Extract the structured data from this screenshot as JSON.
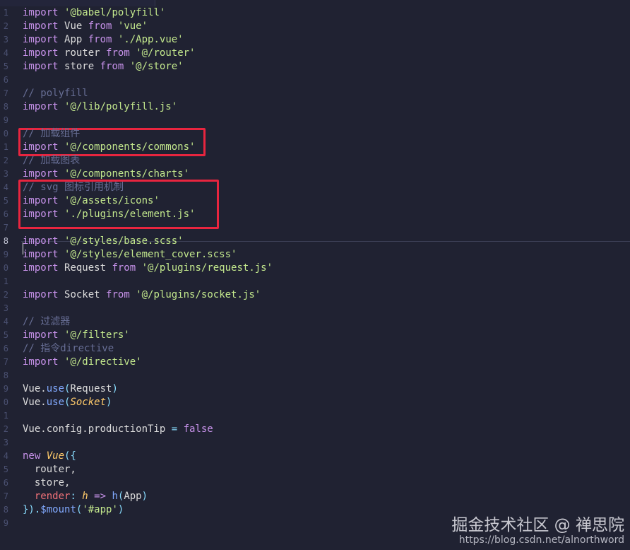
{
  "editor": {
    "lines": [
      {
        "n": "1",
        "t": [
          {
            "c": "kw",
            "s": "import "
          },
          {
            "c": "str",
            "s": "'@babel/polyfill'"
          }
        ]
      },
      {
        "n": "2",
        "t": [
          {
            "c": "kw",
            "s": "import "
          },
          {
            "c": "",
            "s": "Vue "
          },
          {
            "c": "kw",
            "s": "from "
          },
          {
            "c": "str",
            "s": "'vue'"
          }
        ]
      },
      {
        "n": "3",
        "t": [
          {
            "c": "kw",
            "s": "import "
          },
          {
            "c": "",
            "s": "App "
          },
          {
            "c": "kw",
            "s": "from "
          },
          {
            "c": "str",
            "s": "'./App.vue'"
          }
        ]
      },
      {
        "n": "4",
        "t": [
          {
            "c": "kw",
            "s": "import "
          },
          {
            "c": "",
            "s": "router "
          },
          {
            "c": "kw",
            "s": "from "
          },
          {
            "c": "str",
            "s": "'@/router'"
          }
        ]
      },
      {
        "n": "5",
        "t": [
          {
            "c": "kw",
            "s": "import "
          },
          {
            "c": "",
            "s": "store "
          },
          {
            "c": "kw",
            "s": "from "
          },
          {
            "c": "str",
            "s": "'@/store'"
          }
        ]
      },
      {
        "n": "6",
        "t": []
      },
      {
        "n": "7",
        "t": [
          {
            "c": "cm",
            "s": "// polyfill"
          }
        ]
      },
      {
        "n": "8",
        "t": [
          {
            "c": "kw",
            "s": "import "
          },
          {
            "c": "str",
            "s": "'@/lib/polyfill.js'"
          }
        ]
      },
      {
        "n": "9",
        "t": []
      },
      {
        "n": "0",
        "t": [
          {
            "c": "cm",
            "s": "// 加载组件"
          }
        ]
      },
      {
        "n": "1",
        "t": [
          {
            "c": "kw",
            "s": "import "
          },
          {
            "c": "str",
            "s": "'@/components/commons'"
          }
        ]
      },
      {
        "n": "2",
        "t": [
          {
            "c": "cm",
            "s": "// 加载图表"
          }
        ]
      },
      {
        "n": "3",
        "t": [
          {
            "c": "kw",
            "s": "import "
          },
          {
            "c": "str",
            "s": "'@/components/charts'"
          }
        ]
      },
      {
        "n": "4",
        "t": [
          {
            "c": "cm",
            "s": "// svg 图标引用机制"
          }
        ]
      },
      {
        "n": "5",
        "t": [
          {
            "c": "kw",
            "s": "import "
          },
          {
            "c": "str",
            "s": "'@/assets/icons'"
          }
        ]
      },
      {
        "n": "6",
        "t": [
          {
            "c": "kw",
            "s": "import "
          },
          {
            "c": "str",
            "s": "'./plugins/element.js'"
          }
        ]
      },
      {
        "n": "7",
        "t": []
      },
      {
        "n": "8",
        "t": [
          {
            "c": "kw",
            "s": "import "
          },
          {
            "c": "str",
            "s": "'@/styles/base.scss'"
          }
        ],
        "active": true
      },
      {
        "n": "9",
        "t": [
          {
            "c": "kw",
            "s": "import "
          },
          {
            "c": "str",
            "s": "'@/styles/element_cover.scss'"
          }
        ]
      },
      {
        "n": "0",
        "t": [
          {
            "c": "kw",
            "s": "import "
          },
          {
            "c": "",
            "s": "Request "
          },
          {
            "c": "kw",
            "s": "from "
          },
          {
            "c": "str",
            "s": "'@/plugins/request.js'"
          }
        ]
      },
      {
        "n": "1",
        "t": []
      },
      {
        "n": "2",
        "t": [
          {
            "c": "kw",
            "s": "import "
          },
          {
            "c": "",
            "s": "Socket "
          },
          {
            "c": "kw",
            "s": "from "
          },
          {
            "c": "str",
            "s": "'@/plugins/socket.js'"
          }
        ]
      },
      {
        "n": "3",
        "t": []
      },
      {
        "n": "4",
        "t": [
          {
            "c": "cm",
            "s": "// 过滤器"
          }
        ]
      },
      {
        "n": "5",
        "t": [
          {
            "c": "kw",
            "s": "import "
          },
          {
            "c": "str",
            "s": "'@/filters'"
          }
        ]
      },
      {
        "n": "6",
        "t": [
          {
            "c": "cm",
            "s": "// 指令directive"
          }
        ]
      },
      {
        "n": "7",
        "t": [
          {
            "c": "kw",
            "s": "import "
          },
          {
            "c": "str",
            "s": "'@/directive'"
          }
        ]
      },
      {
        "n": "8",
        "t": []
      },
      {
        "n": "9",
        "t": [
          {
            "c": "",
            "s": "Vue."
          },
          {
            "c": "fn",
            "s": "use"
          },
          {
            "c": "pn",
            "s": "("
          },
          {
            "c": "",
            "s": "Request"
          },
          {
            "c": "pn",
            "s": ")"
          }
        ]
      },
      {
        "n": "0",
        "t": [
          {
            "c": "",
            "s": "Vue."
          },
          {
            "c": "fn",
            "s": "use"
          },
          {
            "c": "pn",
            "s": "("
          },
          {
            "c": "cls",
            "s": "Socket"
          },
          {
            "c": "pn",
            "s": ")"
          }
        ]
      },
      {
        "n": "1",
        "t": []
      },
      {
        "n": "2",
        "t": [
          {
            "c": "",
            "s": "Vue.config.productionTip "
          },
          {
            "c": "pn",
            "s": "= "
          },
          {
            "c": "kw",
            "s": "false"
          }
        ]
      },
      {
        "n": "3",
        "t": []
      },
      {
        "n": "4",
        "t": [
          {
            "c": "kw",
            "s": "new "
          },
          {
            "c": "cls",
            "s": "Vue"
          },
          {
            "c": "pn",
            "s": "({"
          }
        ]
      },
      {
        "n": "5",
        "t": [
          {
            "c": "",
            "s": "  router,"
          }
        ]
      },
      {
        "n": "6",
        "t": [
          {
            "c": "",
            "s": "  store,"
          }
        ]
      },
      {
        "n": "7",
        "t": [
          {
            "c": "",
            "s": "  "
          },
          {
            "c": "prop",
            "s": "render"
          },
          {
            "c": "pn",
            "s": ": "
          },
          {
            "c": "cls",
            "s": "h"
          },
          {
            "c": "kw",
            "s": " => "
          },
          {
            "c": "fn",
            "s": "h"
          },
          {
            "c": "pn",
            "s": "("
          },
          {
            "c": "",
            "s": "App"
          },
          {
            "c": "pn",
            "s": ")"
          }
        ]
      },
      {
        "n": "8",
        "t": [
          {
            "c": "pn",
            "s": "})."
          },
          {
            "c": "fn",
            "s": "$mount"
          },
          {
            "c": "pn",
            "s": "("
          },
          {
            "c": "str",
            "s": "'#app'"
          },
          {
            "c": "pn",
            "s": ")"
          }
        ]
      },
      {
        "n": "9",
        "t": []
      }
    ]
  },
  "watermark": {
    "main": "掘金技术社区 @ 禅思院",
    "url": "https://blog.csdn.net/alnorthword"
  },
  "colors": {
    "background": "#202232",
    "keyword": "#c792ea",
    "string": "#c3e88d",
    "comment": "#676e95",
    "highlight_box": "#e8253f"
  }
}
